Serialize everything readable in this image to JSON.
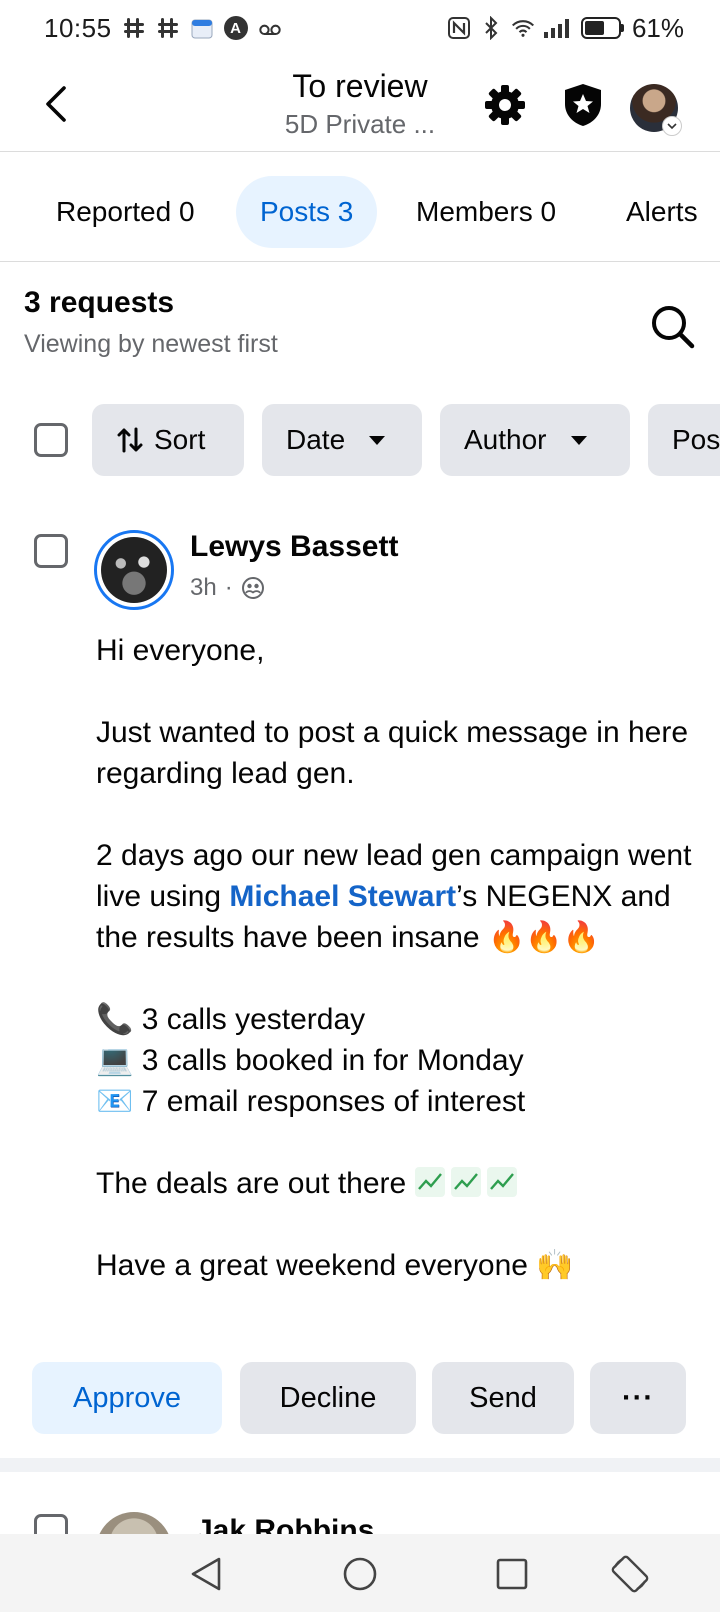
{
  "status_bar": {
    "time": "10:55",
    "battery": "61%",
    "battery_level": 0.61,
    "icons": [
      "slack-icon",
      "slack-icon",
      "calendar-icon",
      "a-badge-icon",
      "voicemail-icon",
      "nfc-icon",
      "bluetooth-icon",
      "wifi-icon",
      "signal-icon",
      "battery-icon"
    ]
  },
  "header": {
    "title": "To review",
    "subtitle": "5D Private ...",
    "icons": [
      "back-arrow-icon",
      "gear-icon",
      "shield-star-icon",
      "avatar"
    ]
  },
  "tabs": [
    {
      "label": "Reported 0",
      "active": false
    },
    {
      "label": "Posts 3",
      "active": true
    },
    {
      "label": "Members 0",
      "active": false
    },
    {
      "label": "Alerts",
      "active": false
    }
  ],
  "requests": {
    "title": "3 requests",
    "subtitle": "Viewing by newest first"
  },
  "filters": {
    "sort": "Sort",
    "date": "Date",
    "author": "Author",
    "post": "Pos"
  },
  "post": {
    "author": "Lewys Bassett",
    "time": "3h",
    "dot": "·",
    "body": {
      "greeting": "Hi everyone,",
      "line1": "Just wanted to post a quick message in here regarding lead gen.",
      "line2_before": "2 days ago our new lead gen campaign went live using ",
      "line2_mention": "Michael Stewart",
      "line2_after": "’s NEGENX and the results have been insane ",
      "fire": "🔥🔥🔥",
      "stats": [
        {
          "emoji": "📞",
          "text": "3 calls yesterday"
        },
        {
          "emoji": "💻",
          "text": "3 calls booked in for Monday"
        },
        {
          "emoji": "📧",
          "text": "7 email responses of interest"
        }
      ],
      "deals": "The deals are out there ",
      "closing": "Have a great weekend everyone ",
      "closing_emoji": "🙌"
    },
    "actions": {
      "approve": "Approve",
      "decline": "Decline",
      "send": "Send",
      "more": "···"
    }
  },
  "next_post": {
    "author": "Jak Robbins"
  },
  "colors": {
    "accent": "#0064d1",
    "accent_bg": "#e7f3ff",
    "chip_bg": "#e4e6eb",
    "mention": "#1464c8",
    "secondary_text": "#65676b"
  }
}
